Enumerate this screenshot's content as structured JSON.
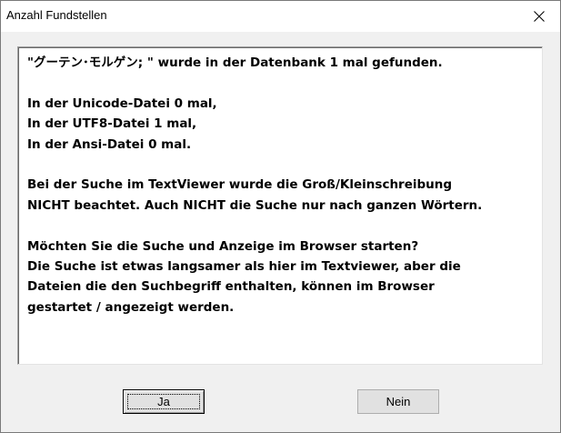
{
  "window": {
    "title": "Anzahl Fundstellen"
  },
  "icons": {
    "close": "close-icon"
  },
  "message": {
    "lines": [
      "\"グーテン･モルゲン; \" wurde in der Datenbank 1 mal gefunden.",
      "",
      "In der Unicode-Datei 0 mal,",
      "In der UTF8-Datei 1 mal,",
      "In der Ansi-Datei 0 mal.",
      "",
      "Bei der Suche im TextViewer wurde die Groß/Kleinschreibung",
      "NICHT beachtet. Auch NICHT die Suche nur nach ganzen Wörtern.",
      "",
      "Möchten Sie die Suche und Anzeige im Browser starten?",
      "Die Suche ist etwas langsamer als hier im Textviewer, aber die",
      "Dateien die den Suchbegriff enthalten, können im Browser",
      "gestartet / angezeigt werden."
    ]
  },
  "buttons": {
    "yes_label": "Ja",
    "no_label": "Nein"
  }
}
